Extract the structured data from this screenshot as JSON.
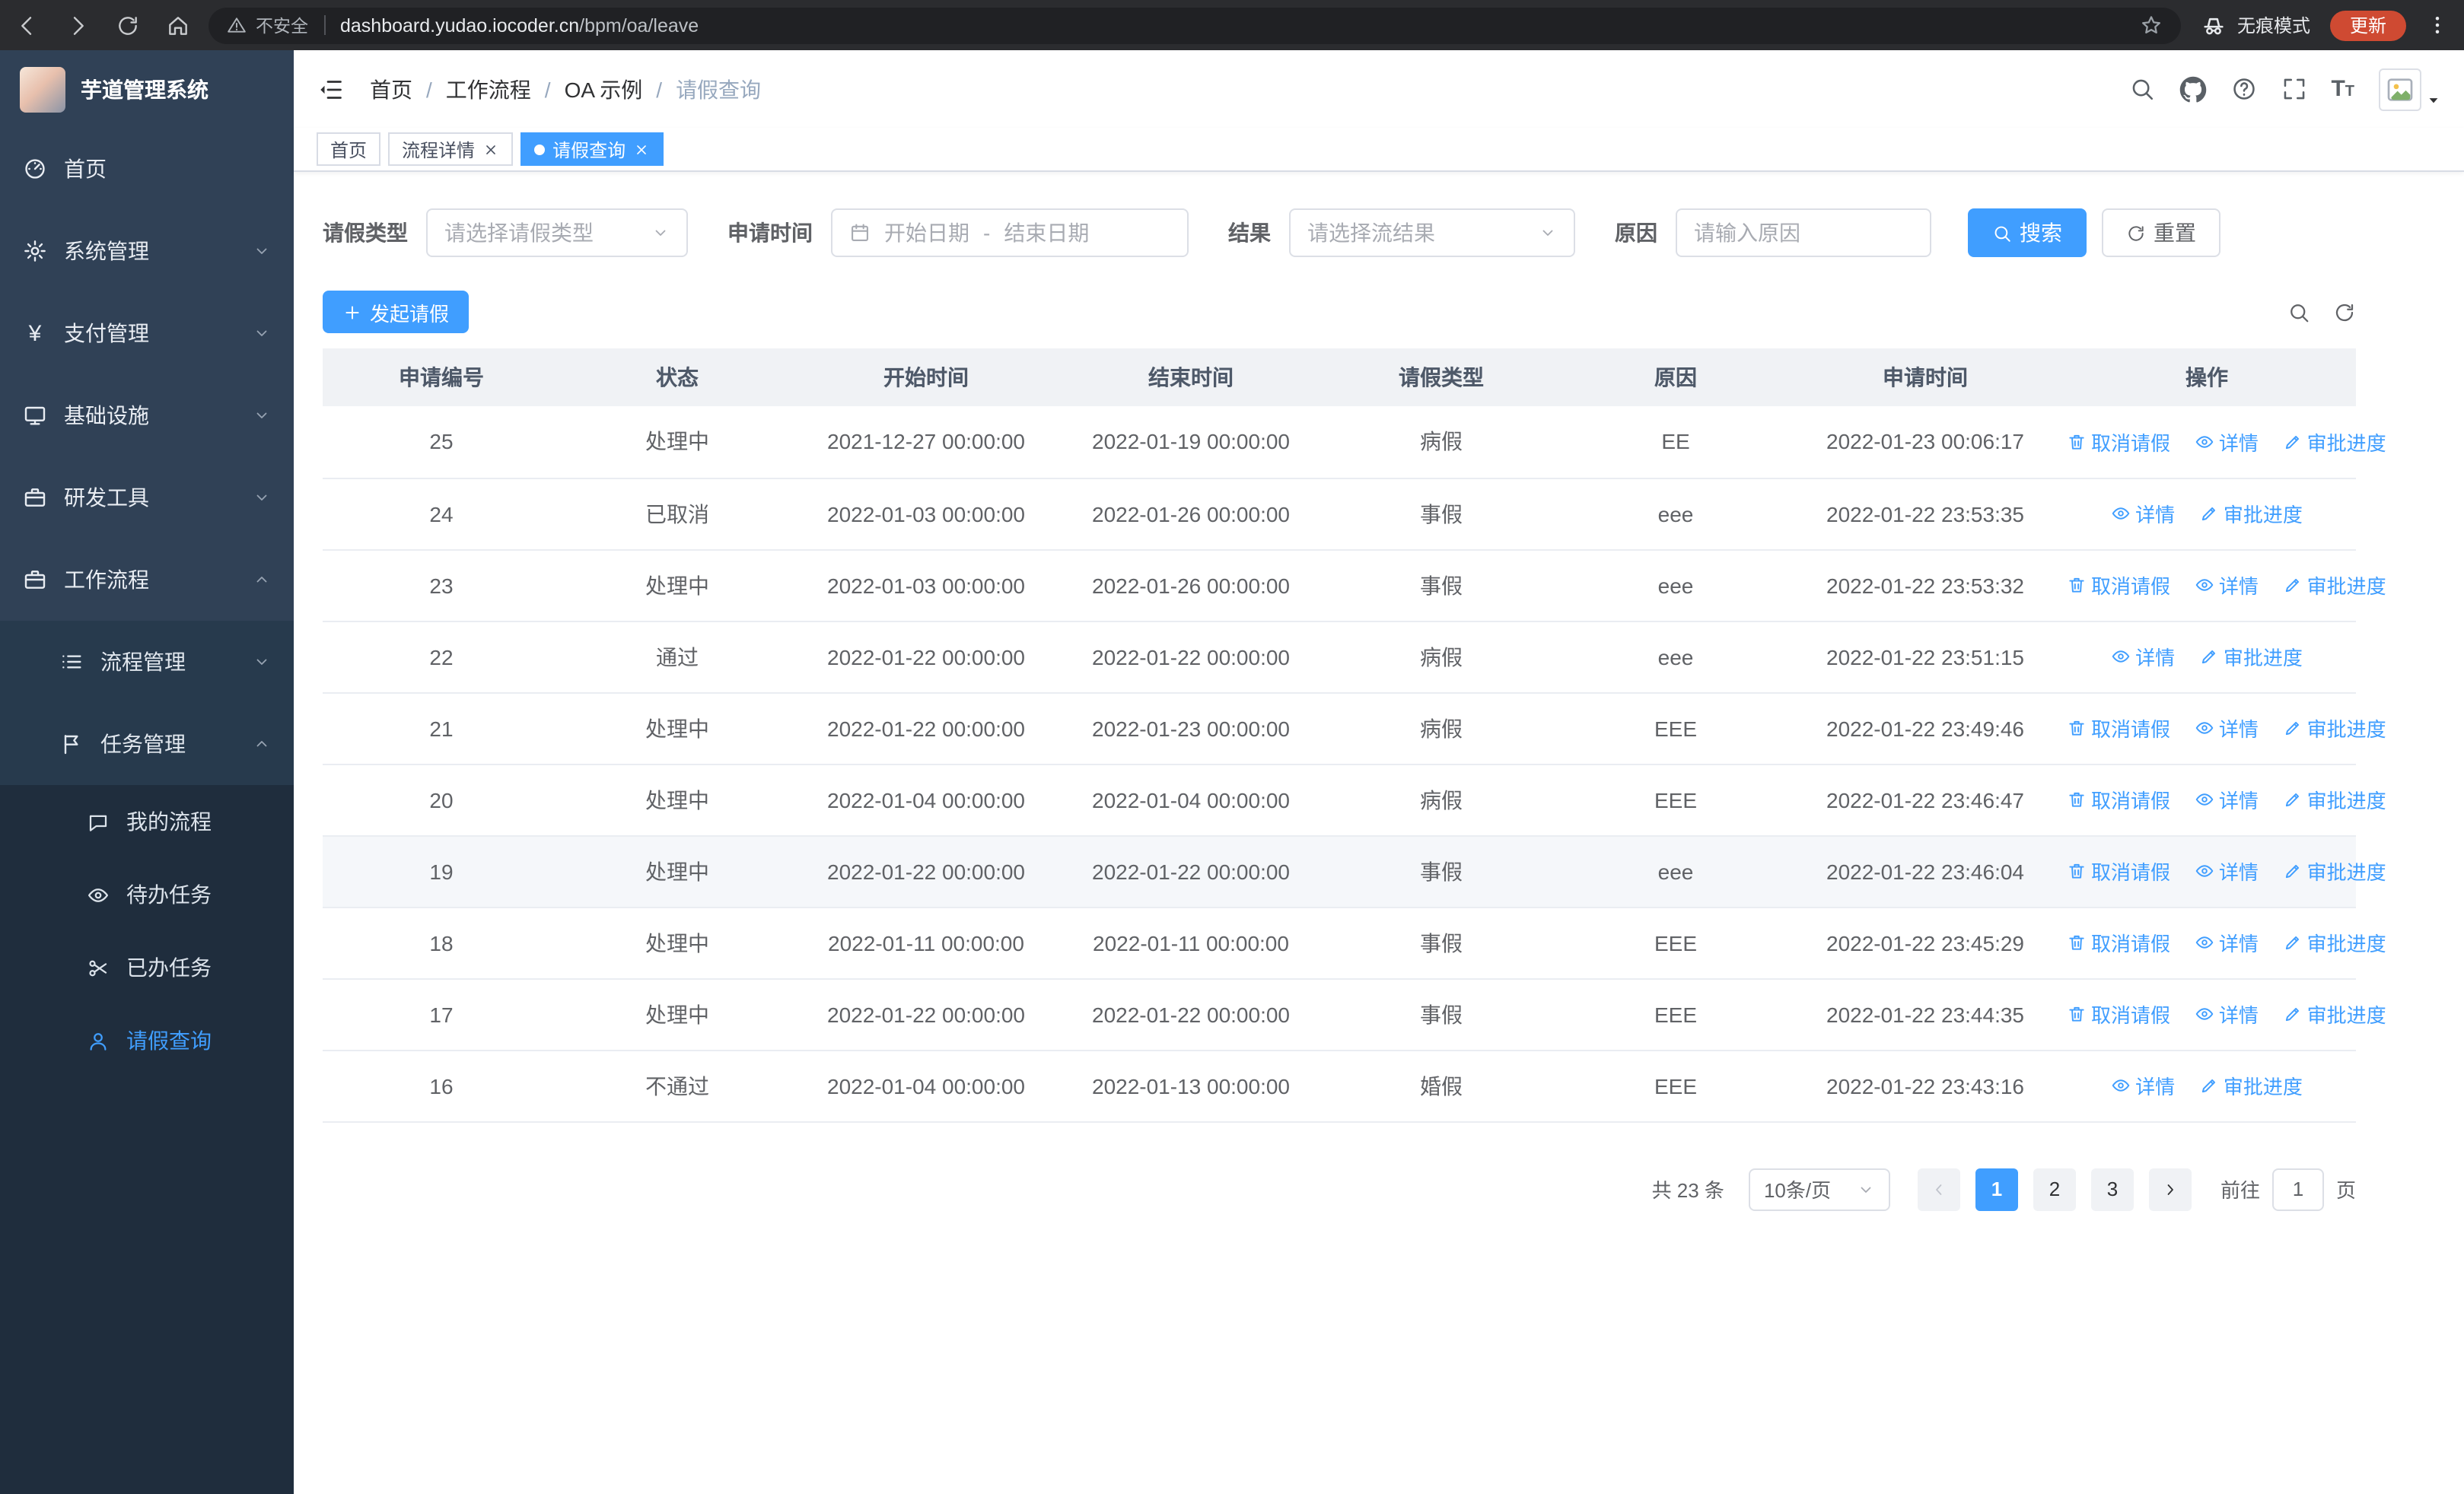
{
  "browser": {
    "security_warning": "不安全",
    "url_domain": "dashboard.yudao.iocoder.cn",
    "url_path": "/bpm/oa/leave",
    "incognito_label": "无痕模式",
    "update_label": "更新"
  },
  "sidebar": {
    "title": "芋道管理系统",
    "items": [
      {
        "label": "首页",
        "icon": "dashboard-icon"
      },
      {
        "label": "系统管理",
        "icon": "gear-icon",
        "expanded": false
      },
      {
        "label": "支付管理",
        "icon": "yen-icon",
        "expanded": false
      },
      {
        "label": "基础设施",
        "icon": "monitor-icon",
        "expanded": false
      },
      {
        "label": "研发工具",
        "icon": "briefcase-icon",
        "expanded": false
      },
      {
        "label": "工作流程",
        "icon": "briefcase-icon",
        "expanded": true
      }
    ],
    "sub_items": [
      {
        "label": "流程管理",
        "icon": "list-icon",
        "expanded": false
      },
      {
        "label": "任务管理",
        "icon": "flag-icon",
        "expanded": true
      }
    ],
    "leaf_items": [
      {
        "label": "我的流程",
        "icon": "chat-icon",
        "active": false
      },
      {
        "label": "待办任务",
        "icon": "eye-icon",
        "active": false
      },
      {
        "label": "已办任务",
        "icon": "scissors-icon",
        "active": false
      },
      {
        "label": "请假查询",
        "icon": "user-icon",
        "active": true
      }
    ]
  },
  "header": {
    "breadcrumb": [
      "首页",
      "工作流程",
      "OA 示例",
      "请假查询"
    ],
    "header_icons": [
      "search-icon",
      "github-icon",
      "help-icon",
      "fullscreen-icon",
      "font-size-icon",
      "avatar"
    ]
  },
  "tabs": [
    {
      "label": "首页",
      "closable": false,
      "active": false
    },
    {
      "label": "流程详情",
      "closable": true,
      "active": false
    },
    {
      "label": "请假查询",
      "closable": true,
      "active": true
    }
  ],
  "filters": {
    "leave_type_label": "请假类型",
    "leave_type_placeholder": "请选择请假类型",
    "apply_time_label": "申请时间",
    "start_date_placeholder": "开始日期",
    "range_separator": "-",
    "end_date_placeholder": "结束日期",
    "result_label": "结果",
    "result_placeholder": "请选择流结果",
    "reason_label": "原因",
    "reason_placeholder": "请输入原因",
    "search_button": "搜索",
    "reset_button": "重置"
  },
  "toolbar": {
    "create_button": "发起请假"
  },
  "table": {
    "columns": [
      "申请编号",
      "状态",
      "开始时间",
      "结束时间",
      "请假类型",
      "原因",
      "申请时间",
      "操作"
    ],
    "actions": {
      "cancel": "取消请假",
      "detail": "详情",
      "progress": "审批进度"
    },
    "rows": [
      {
        "id": "25",
        "status": "处理中",
        "start": "2021-12-27 00:00:00",
        "end": "2022-01-19 00:00:00",
        "type": "病假",
        "reason": "EE",
        "applied": "2022-01-23 00:06:17",
        "can_cancel": true
      },
      {
        "id": "24",
        "status": "已取消",
        "start": "2022-01-03 00:00:00",
        "end": "2022-01-26 00:00:00",
        "type": "事假",
        "reason": "eee",
        "applied": "2022-01-22 23:53:35",
        "can_cancel": false
      },
      {
        "id": "23",
        "status": "处理中",
        "start": "2022-01-03 00:00:00",
        "end": "2022-01-26 00:00:00",
        "type": "事假",
        "reason": "eee",
        "applied": "2022-01-22 23:53:32",
        "can_cancel": true
      },
      {
        "id": "22",
        "status": "通过",
        "start": "2022-01-22 00:00:00",
        "end": "2022-01-22 00:00:00",
        "type": "病假",
        "reason": "eee",
        "applied": "2022-01-22 23:51:15",
        "can_cancel": false
      },
      {
        "id": "21",
        "status": "处理中",
        "start": "2022-01-22 00:00:00",
        "end": "2022-01-23 00:00:00",
        "type": "病假",
        "reason": "EEE",
        "applied": "2022-01-22 23:49:46",
        "can_cancel": true
      },
      {
        "id": "20",
        "status": "处理中",
        "start": "2022-01-04 00:00:00",
        "end": "2022-01-04 00:00:00",
        "type": "病假",
        "reason": "EEE",
        "applied": "2022-01-22 23:46:47",
        "can_cancel": true
      },
      {
        "id": "19",
        "status": "处理中",
        "start": "2022-01-22 00:00:00",
        "end": "2022-01-22 00:00:00",
        "type": "事假",
        "reason": "eee",
        "applied": "2022-01-22 23:46:04",
        "can_cancel": true,
        "highlight": true
      },
      {
        "id": "18",
        "status": "处理中",
        "start": "2022-01-11 00:00:00",
        "end": "2022-01-11 00:00:00",
        "type": "事假",
        "reason": "EEE",
        "applied": "2022-01-22 23:45:29",
        "can_cancel": true
      },
      {
        "id": "17",
        "status": "处理中",
        "start": "2022-01-22 00:00:00",
        "end": "2022-01-22 00:00:00",
        "type": "事假",
        "reason": "EEE",
        "applied": "2022-01-22 23:44:35",
        "can_cancel": true
      },
      {
        "id": "16",
        "status": "不通过",
        "start": "2022-01-04 00:00:00",
        "end": "2022-01-13 00:00:00",
        "type": "婚假",
        "reason": "EEE",
        "applied": "2022-01-22 23:43:16",
        "can_cancel": false
      }
    ]
  },
  "pagination": {
    "total_text": "共 23 条",
    "page_size": "10条/页",
    "pages": [
      "1",
      "2",
      "3"
    ],
    "active_page": "1",
    "goto_label": "前往",
    "goto_value": "1",
    "goto_suffix": "页"
  },
  "colors": {
    "primary": "#409eff",
    "sidebar_bg": "#304156",
    "sidebar_sub_bg": "#1f2d3d"
  }
}
